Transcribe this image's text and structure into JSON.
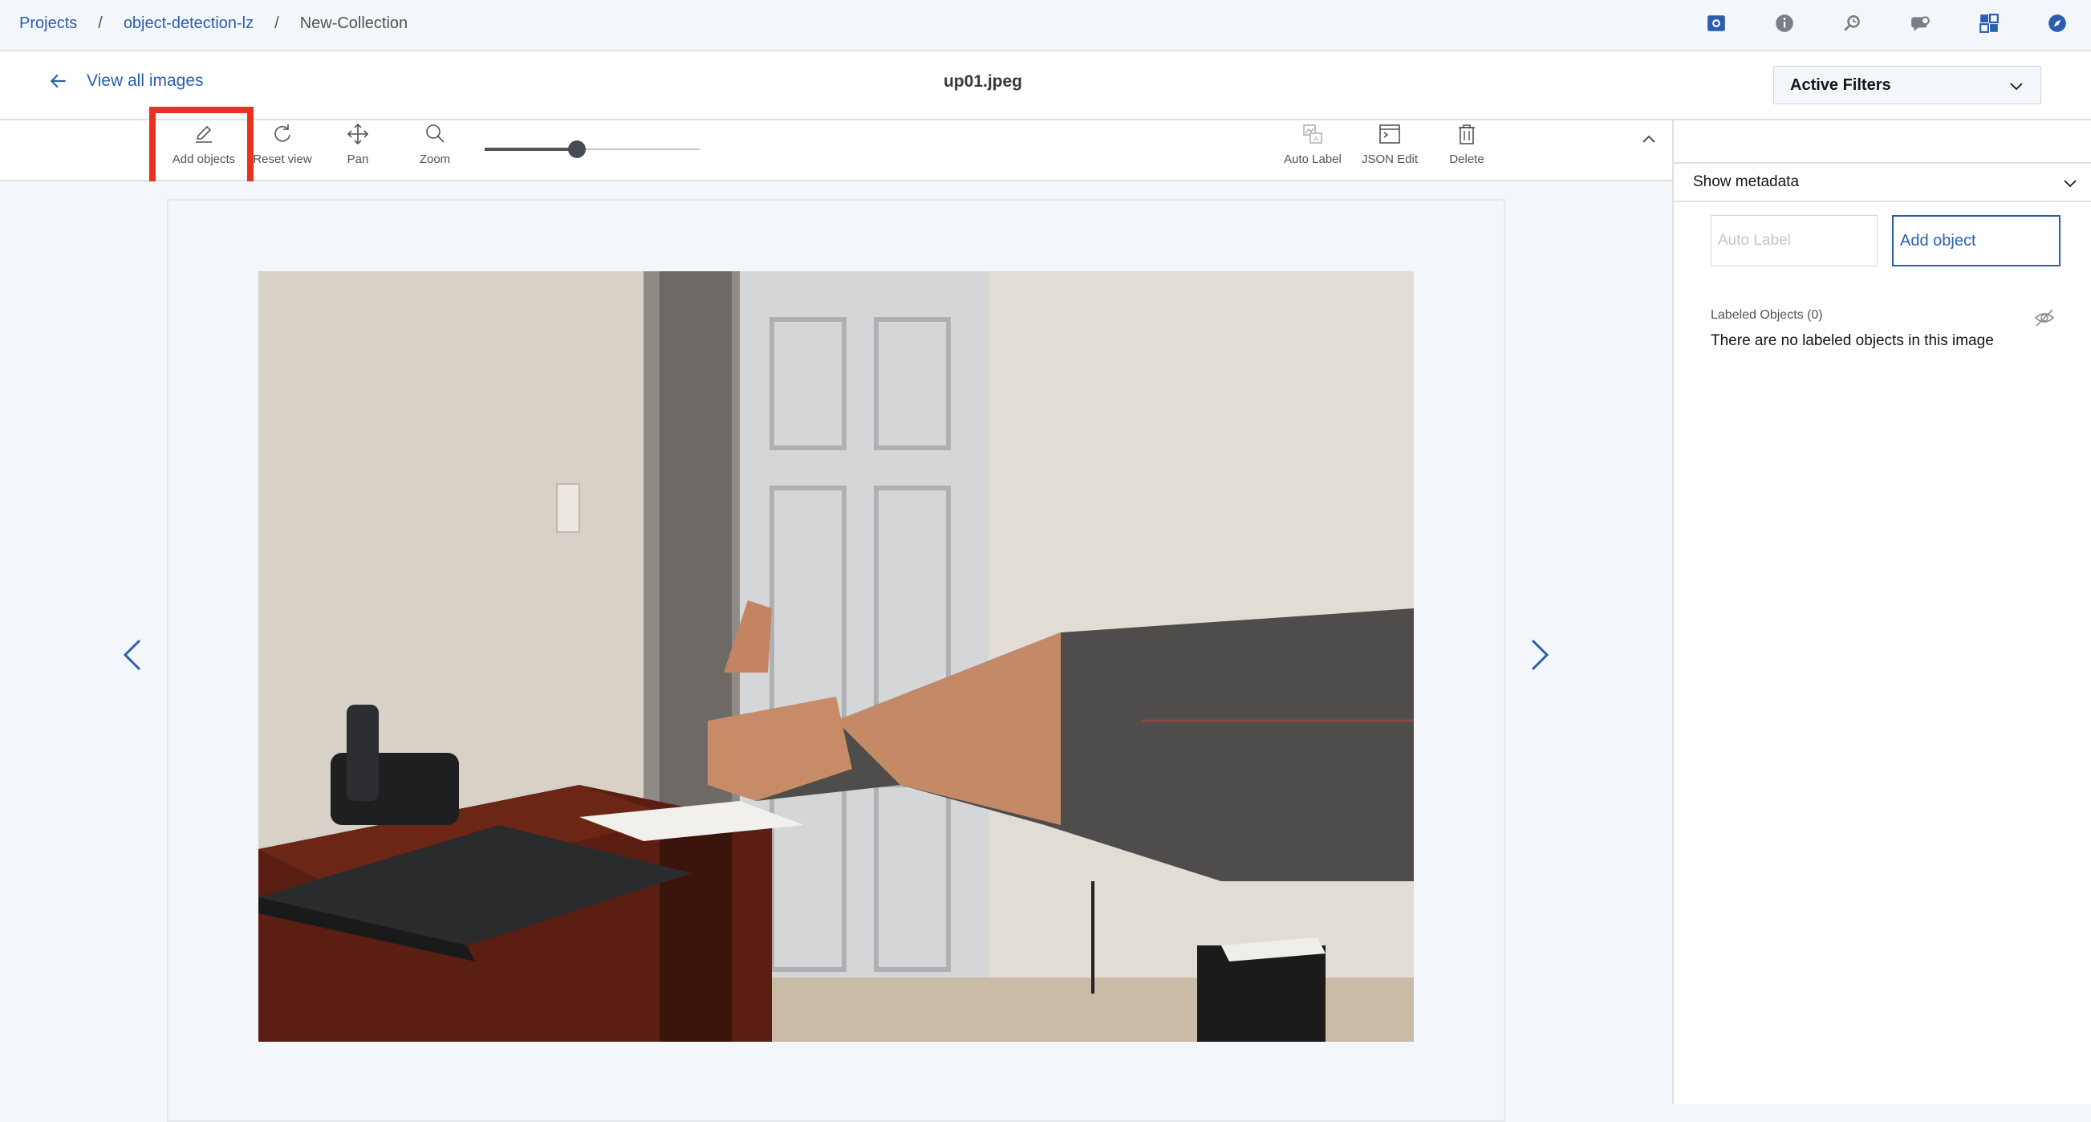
{
  "breadcrumb": {
    "items": [
      "Projects",
      "object-detection-lz"
    ],
    "separator": "/",
    "current": "New-Collection"
  },
  "topbar_icons": [
    "camera-icon",
    "info-icon",
    "search-history-icon",
    "chat-icon",
    "dashboard-icon",
    "compass-icon"
  ],
  "header": {
    "back_label": "View all images",
    "file_name": "up01.jpeg",
    "filters_label": "Active Filters"
  },
  "toolbar": {
    "add_objects": "Add objects",
    "reset_view": "Reset view",
    "pan": "Pan",
    "zoom": "Zoom",
    "auto_label": "Auto Label",
    "json_edit": "JSON Edit",
    "delete": "Delete",
    "zoom_level_fraction": 0.43
  },
  "side_panel": {
    "show_metadata": "Show metadata",
    "auto_label_placeholder": "Auto Label",
    "add_object_button": "Add object",
    "labeled_objects_title": "Labeled Objects (0)",
    "empty_message": "There are no labeled objects in this image"
  },
  "colors": {
    "accent": "#2b5eae",
    "highlight": "#e8311f",
    "background": "#f3f6fa"
  }
}
